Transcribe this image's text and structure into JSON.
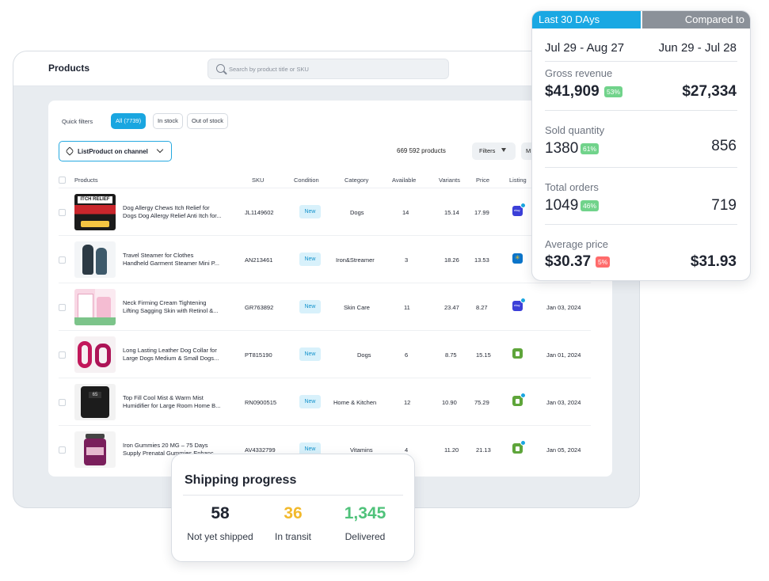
{
  "app": {
    "title": "Products",
    "search_placeholder": "Search by product title or SKU"
  },
  "filters": {
    "quick_label": "Quick filters",
    "chips": [
      "All (7739)",
      "In stock",
      "Out of stock"
    ],
    "list_dropdown": "ListProduct on channel",
    "count_text": "669 592 products",
    "filters_button": "Filters",
    "more_button": "M"
  },
  "table": {
    "headers": [
      "Products",
      "SKU",
      "Condition",
      "Category",
      "Available",
      "Variants",
      "Price",
      "Listing"
    ],
    "rows": [
      {
        "name1": "Dog Allergy Chews Itch Relief for",
        "name2": "Dogs Dog Allergy Relief Anti Itch for...",
        "sku": "JL1149602",
        "condition": "New",
        "category": "Dogs",
        "available": "14",
        "variants": "15.14",
        "price": "17.99",
        "channel": "ebay",
        "date": ""
      },
      {
        "name1": "Travel Steamer for Clothes",
        "name2": "Handheld Garment Steamer Mini P...",
        "sku": "AN213461",
        "condition": "New",
        "category": "Iron&Streamer",
        "available": "3",
        "variants": "18.26",
        "price": "13.53",
        "channel": "walmart",
        "date": ""
      },
      {
        "name1": "Neck Firming Cream Tightening",
        "name2": "Lifting Sagging Skin with Retinol &...",
        "sku": "GR763892",
        "condition": "New",
        "category": "Skin Care",
        "available": "11",
        "variants": "23.47",
        "price": "8.27",
        "channel": "ebay",
        "date": "Jan 03, 2024"
      },
      {
        "name1": "Long Lasting Leather Dog Collar for",
        "name2": "Large Dogs Medium & Small Dogs...",
        "sku": "PT815190",
        "condition": "New",
        "category": "Dogs",
        "available": "6",
        "variants": "8.75",
        "price": "15.15",
        "channel": "shopify",
        "date": "Jan 01, 2024"
      },
      {
        "name1": "Top Fill Cool Mist & Warm Mist",
        "name2": "Humidifier for Large Room Home B...",
        "sku": "RN0900515",
        "condition": "New",
        "category": "Home & Kitchen",
        "available": "12",
        "variants": "10.90",
        "price": "75.29",
        "channel": "shopify",
        "date": "Jan 03, 2024"
      },
      {
        "name1": "Iron Gummies 20 MG – 75 Days",
        "name2": "Supply Prenatal Gummies Enhanc...",
        "sku": "AV4332799",
        "condition": "New",
        "category": "Vitamins",
        "available": "4",
        "variants": "11.20",
        "price": "21.13",
        "channel": "shopify",
        "date": "Jan 05, 2024"
      }
    ]
  },
  "shipping": {
    "title": "Shipping progress",
    "metrics": [
      {
        "value": "58",
        "label": "Not yet shipped",
        "color": "#1f2430"
      },
      {
        "value": "36",
        "label": "In transit",
        "color": "#f2b92c"
      },
      {
        "value": "1,345",
        "label": "Delivered",
        "color": "#4fc27a"
      }
    ]
  },
  "stats": {
    "head_left": "Last 30 DAys",
    "head_right": "Compared to",
    "range_current": "Jul 29 - Aug 27",
    "range_previous": "Jun 29 - Jul 28",
    "metrics": [
      {
        "label": "Gross revenue",
        "current": "$41,909",
        "change": "53%",
        "direction": "up",
        "previous": "$27,334"
      },
      {
        "label": "Sold quantity",
        "current": "1380",
        "change": "61%",
        "direction": "up",
        "previous": "856"
      },
      {
        "label": "Total orders",
        "current": "1049",
        "change": "46%",
        "direction": "up",
        "previous": "719"
      },
      {
        "label": "Average price",
        "current": "$30.37",
        "change": "5%",
        "direction": "down",
        "previous": "$31.93"
      }
    ]
  }
}
